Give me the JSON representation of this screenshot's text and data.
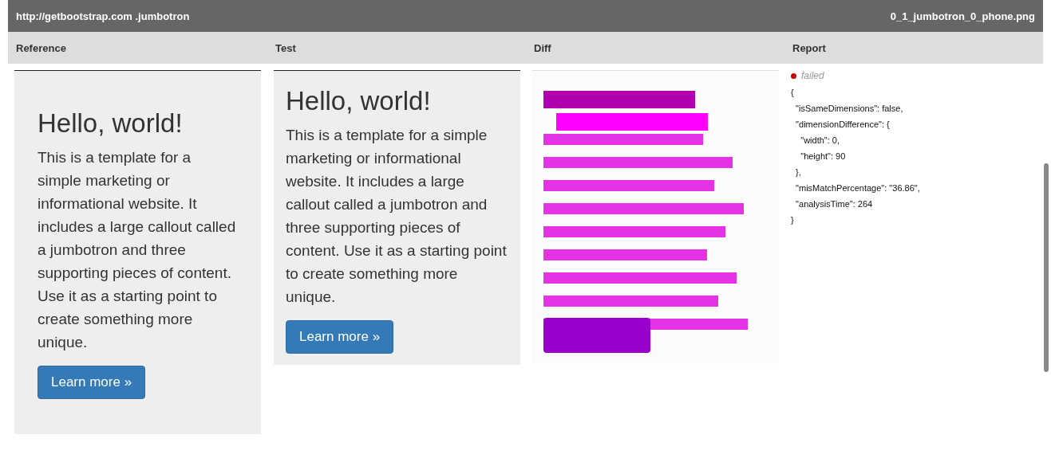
{
  "header": {
    "url": "http://getbootstrap.com .jumbotron",
    "filename": "0_1_jumbotron_0_phone.png"
  },
  "columns": [
    {
      "title": "Reference"
    },
    {
      "title": "Test"
    },
    {
      "title": "Diff"
    },
    {
      "title": "Report"
    }
  ],
  "reference": {
    "heading": "Hello, world!",
    "text": "This is a template for a simple marketing or informational website. It includes a large callout called a jumbotron and three supporting pieces of content. Use it as a starting point to create something more unique.",
    "button": "Learn more »"
  },
  "test": {
    "heading": "Hello, world!",
    "text": "This is a template for a simple marketing or informational website. It includes a large callout called a jumbotron and three supporting pieces of content. Use it as a starting point to create something more unique.",
    "button": "Learn more »"
  },
  "report": {
    "status": "failed",
    "json": "{\n  \"isSameDimensions\": false,\n  \"dimensionDifference\": {\n    \"width\": 0,\n    \"height\": 90\n  },\n  \"misMatchPercentage\": \"36.86\",\n  \"analysisTime\": 264\n}"
  }
}
